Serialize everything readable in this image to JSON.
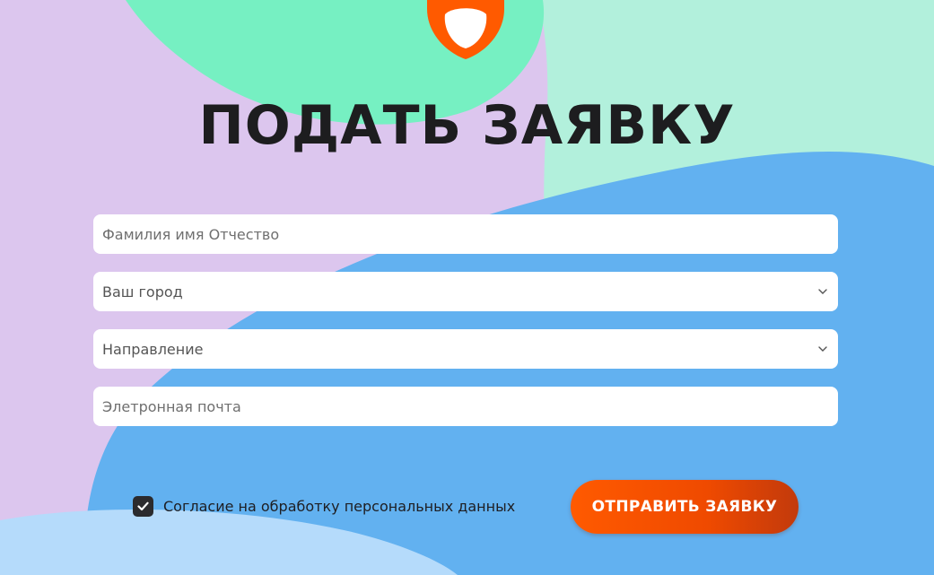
{
  "form": {
    "title": "ПОДАТЬ ЗАЯВКУ",
    "full_name_placeholder": "Фамилия имя Отчество",
    "city_select_value": "Ваш город",
    "direction_select_value": "Направление",
    "email_placeholder": "Элетронная почта",
    "consent_label": "Согласие на обработку персональных данных",
    "consent_checked": true,
    "submit_label": "ОТПРАВИТЬ ЗАЯВКУ"
  },
  "icons": {
    "logo": "shield-logo-icon",
    "select_chevron": "chevron-down-icon",
    "checkbox_check": "check-icon"
  },
  "colors": {
    "background_lavender": "#dcc6ee",
    "background_mint": "#76f0c2",
    "background_pale_mint": "#b2f0dc",
    "background_blue": "#62b1f0",
    "background_light_blue": "#b5dbfb",
    "accent_orange": "#ff5a00",
    "title_text": "#1d1d1f"
  }
}
